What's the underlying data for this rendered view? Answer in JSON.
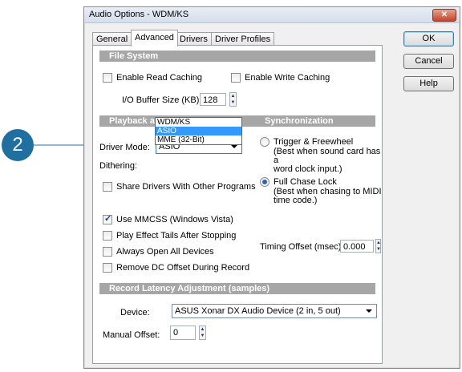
{
  "callout": {
    "number": "2"
  },
  "window": {
    "title": "Audio Options - WDM/KS",
    "close_glyph": "✕"
  },
  "tabs": [
    {
      "label": "General",
      "active": false
    },
    {
      "label": "Advanced",
      "active": true
    },
    {
      "label": "Drivers",
      "active": false
    },
    {
      "label": "Driver Profiles",
      "active": false
    }
  ],
  "buttons": {
    "ok": "OK",
    "cancel": "Cancel",
    "help": "Help"
  },
  "file_system": {
    "header": "File System",
    "enable_read_caching": {
      "label": "Enable Read Caching",
      "checked": false
    },
    "enable_write_caching": {
      "label": "Enable Write Caching",
      "checked": false
    },
    "io_buffer_label": "I/O Buffer Size (KB):",
    "io_buffer_value": "128"
  },
  "playback": {
    "header": "Playback and Recording",
    "driver_mode_label": "Driver Mode:",
    "driver_mode_value": "ASIO",
    "driver_mode_options": [
      "WDM/KS",
      "ASIO",
      "MME (32-Bit)"
    ],
    "driver_mode_highlighted": "ASIO",
    "dithering_label": "Dithering:",
    "share_drivers": {
      "label": "Share Drivers With Other Programs",
      "checked": false
    },
    "use_mmcss": {
      "label": "Use MMCSS (Windows Vista)",
      "checked": true
    },
    "play_effect_tails": {
      "label": "Play Effect Tails After Stopping",
      "checked": false
    },
    "always_open_devices": {
      "label": "Always Open All Devices",
      "checked": false
    },
    "remove_dc_offset": {
      "label": "Remove DC Offset During Record",
      "checked": false
    }
  },
  "sync": {
    "header": "Synchronization",
    "trigger": {
      "label": "Trigger & Freewheel",
      "desc": "(Best when sound card has a\nword clock input.)",
      "selected": false
    },
    "full_chase": {
      "label": "Full Chase Lock",
      "desc": "(Best when chasing to MIDI\ntime code.)",
      "selected": true
    },
    "timing_offset_label": "Timing Offset (msec):",
    "timing_offset_value": "0.000"
  },
  "latency": {
    "header": "Record Latency Adjustment (samples)",
    "device_label": "Device:",
    "device_value": "ASUS Xonar DX Audio Device (2 in, 5 out)",
    "manual_offset_label": "Manual Offset:",
    "manual_offset_value": "0"
  },
  "colors": {
    "header_bg": "#a6a6a6",
    "callout": "#1f6fa0",
    "selection": "#3399ff"
  }
}
